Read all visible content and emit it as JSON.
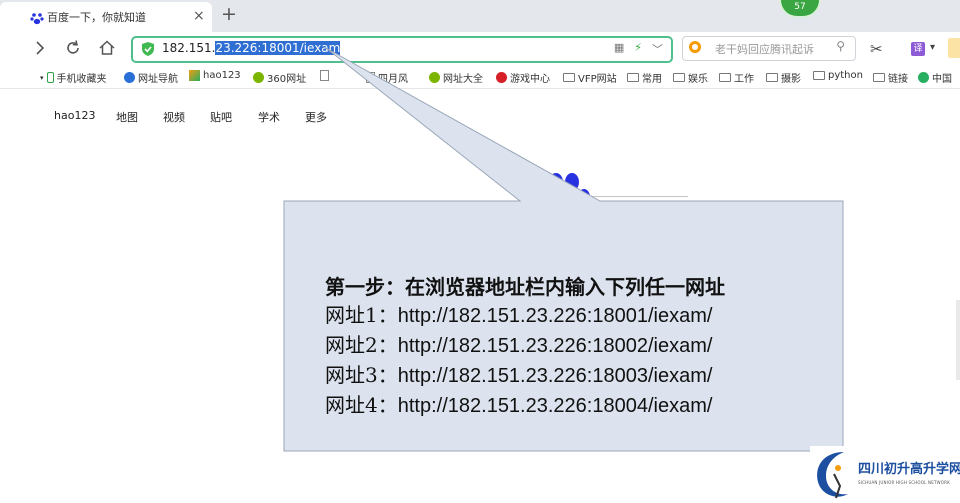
{
  "tab": {
    "title": "百度一下，你就知道",
    "close": "×",
    "new_tab": "+"
  },
  "badge": {
    "count": "57"
  },
  "toolbar": {
    "address_prefix": "182.151.",
    "address_selected": "23.226:18001/iexam",
    "search_placeholder": "老干妈回应腾讯起诉",
    "translate": "译"
  },
  "bookmarks": [
    {
      "label": "手机收藏夹",
      "icon": "phone-icon"
    },
    {
      "label": "网址导航",
      "icon": "nav-icon"
    },
    {
      "label": "hao123",
      "icon": "hao123-icon"
    },
    {
      "label": "360网址",
      "icon": "360-icon"
    },
    {
      "label": "",
      "icon": "page-icon"
    },
    {
      "label": "四月风",
      "icon": "page-icon"
    },
    {
      "label": "网址大全",
      "icon": "360-icon"
    },
    {
      "label": "游戏中心",
      "icon": "game-icon"
    },
    {
      "label": "VFP网站",
      "icon": "folder-icon"
    },
    {
      "label": "常用",
      "icon": "folder-icon"
    },
    {
      "label": "娱乐",
      "icon": "folder-icon"
    },
    {
      "label": "工作",
      "icon": "folder-icon"
    },
    {
      "label": "摄影",
      "icon": "folder-icon"
    },
    {
      "label": "python",
      "icon": "folder-icon"
    },
    {
      "label": "链接",
      "icon": "folder-icon"
    },
    {
      "label": "中国",
      "icon": "globe-icon"
    }
  ],
  "baidu_nav": [
    "hao123",
    "地图",
    "视频",
    "贴吧",
    "学术",
    "更多"
  ],
  "callout": {
    "heading": "第一步：在浏览器地址栏内输入下列任一网址",
    "urls": [
      {
        "label": "网址1：",
        "url": "http://182.151.23.226:18001/iexam/"
      },
      {
        "label": "网址2：",
        "url": "http://182.151.23.226:18002/iexam/"
      },
      {
        "label": "网址3：",
        "url": "http://182.151.23.226:18003/iexam/"
      },
      {
        "label": "网址4：",
        "url": "http://182.151.23.226:18004/iexam/"
      }
    ]
  },
  "watermark": {
    "title": "四川初升高升学网",
    "subtitle": "SICHUAN JUNIOR HIGH SCHOOL NETWORK"
  },
  "colors": {
    "address_border": "#4fc08d",
    "selection": "#2f6fd3",
    "callout_fill": "#dce3ee",
    "callout_stroke": "#9aa7b8",
    "baidu_blue": "#2932e1"
  }
}
